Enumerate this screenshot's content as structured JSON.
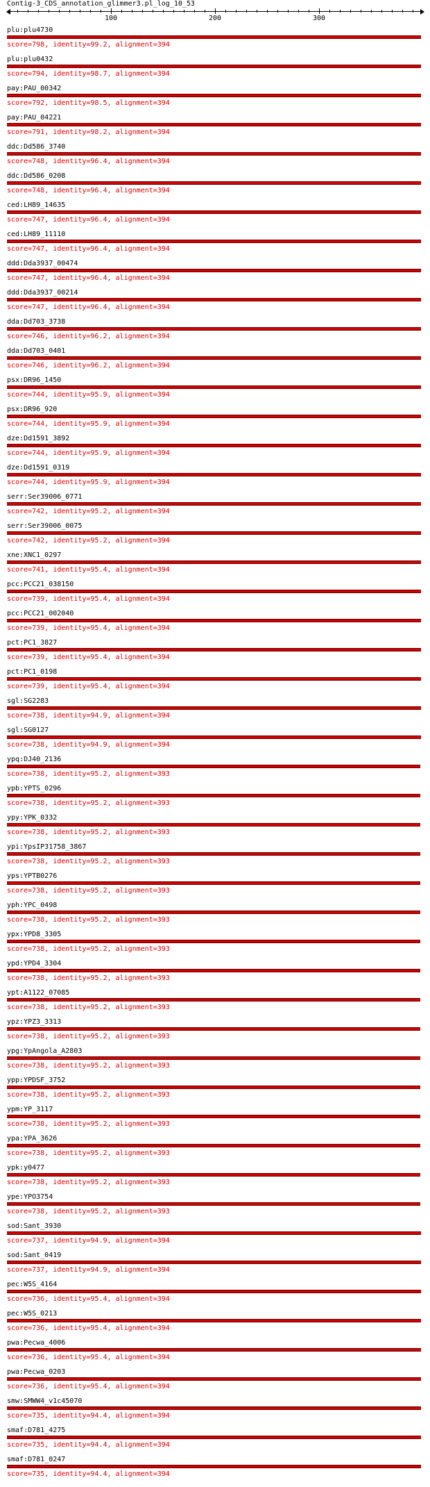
{
  "title": "Contig-3_CDS_annotation_glimmer3.pl_log_10_53",
  "axis": {
    "ticks": [
      "100",
      "200",
      "300"
    ]
  },
  "chart_data": {
    "type": "alignment",
    "query_length": 400,
    "hits": [
      {
        "name": "plu:plu4730",
        "score_line": "score=798, identity=99.2, alignment=394",
        "alignment": 394
      },
      {
        "name": "plu:plu0432",
        "score_line": "score=794, identity=98.7, alignment=394",
        "alignment": 394
      },
      {
        "name": "pay:PAU_00342",
        "score_line": "score=792, identity=98.5, alignment=394",
        "alignment": 394
      },
      {
        "name": "pay:PAU_04221",
        "score_line": "score=791, identity=98.2, alignment=394",
        "alignment": 394
      },
      {
        "name": "ddc:Dd586_3740",
        "score_line": "score=748, identity=96.4, alignment=394",
        "alignment": 394
      },
      {
        "name": "ddc:Dd586_0208",
        "score_line": "score=748, identity=96.4, alignment=394",
        "alignment": 394
      },
      {
        "name": "ced:LH89_14635",
        "score_line": "score=747, identity=96.4, alignment=394",
        "alignment": 394
      },
      {
        "name": "ced:LH89_11110",
        "score_line": "score=747, identity=96.4, alignment=394",
        "alignment": 394
      },
      {
        "name": "ddd:Dda3937_00474",
        "score_line": "score=747, identity=96.4, alignment=394",
        "alignment": 394
      },
      {
        "name": "ddd:Dda3937_00214",
        "score_line": "score=747, identity=96.4, alignment=394",
        "alignment": 394
      },
      {
        "name": "dda:Dd703_3738",
        "score_line": "score=746, identity=96.2, alignment=394",
        "alignment": 394
      },
      {
        "name": "dda:Dd703_0401",
        "score_line": "score=746, identity=96.2, alignment=394",
        "alignment": 394
      },
      {
        "name": "psx:DR96_1450",
        "score_line": "score=744, identity=95.9, alignment=394",
        "alignment": 394
      },
      {
        "name": "psx:DR96_920",
        "score_line": "score=744, identity=95.9, alignment=394",
        "alignment": 394
      },
      {
        "name": "dze:Dd1591_3892",
        "score_line": "score=744, identity=95.9, alignment=394",
        "alignment": 394
      },
      {
        "name": "dze:Dd1591_0319",
        "score_line": "score=744, identity=95.9, alignment=394",
        "alignment": 394
      },
      {
        "name": "serr:Ser39006_0771",
        "score_line": "score=742, identity=95.2, alignment=394",
        "alignment": 394
      },
      {
        "name": "serr:Ser39006_0075",
        "score_line": "score=742, identity=95.2, alignment=394",
        "alignment": 394
      },
      {
        "name": "xne:XNC1_0297",
        "score_line": "score=741, identity=95.4, alignment=394",
        "alignment": 394
      },
      {
        "name": "pcc:PCC21_038150",
        "score_line": "score=739, identity=95.4, alignment=394",
        "alignment": 394
      },
      {
        "name": "pcc:PCC21_002040",
        "score_line": "score=739, identity=95.4, alignment=394",
        "alignment": 394
      },
      {
        "name": "pct:PC1_3827",
        "score_line": "score=739, identity=95.4, alignment=394",
        "alignment": 394
      },
      {
        "name": "pct:PC1_0198",
        "score_line": "score=739, identity=95.4, alignment=394",
        "alignment": 394
      },
      {
        "name": "sgl:SG2283",
        "score_line": "score=738, identity=94.9, alignment=394",
        "alignment": 394
      },
      {
        "name": "sgl:SG0127",
        "score_line": "score=738, identity=94.9, alignment=394",
        "alignment": 394
      },
      {
        "name": "ypq:DJ40_2136",
        "score_line": "score=738, identity=95.2, alignment=393",
        "alignment": 393
      },
      {
        "name": "ypb:YPTS_0296",
        "score_line": "score=738, identity=95.2, alignment=393",
        "alignment": 393
      },
      {
        "name": "ypy:YPK_0332",
        "score_line": "score=738, identity=95.2, alignment=393",
        "alignment": 393
      },
      {
        "name": "ypi:YpsIP31758_3867",
        "score_line": "score=738, identity=95.2, alignment=393",
        "alignment": 393
      },
      {
        "name": "yps:YPTB0276",
        "score_line": "score=738, identity=95.2, alignment=393",
        "alignment": 393
      },
      {
        "name": "yph:YPC_0498",
        "score_line": "score=738, identity=95.2, alignment=393",
        "alignment": 393
      },
      {
        "name": "ypx:YPD8_3305",
        "score_line": "score=738, identity=95.2, alignment=393",
        "alignment": 393
      },
      {
        "name": "ypd:YPD4_3304",
        "score_line": "score=738, identity=95.2, alignment=393",
        "alignment": 393
      },
      {
        "name": "ypt:A1122_07085",
        "score_line": "score=738, identity=95.2, alignment=393",
        "alignment": 393
      },
      {
        "name": "ypz:YPZ3_3313",
        "score_line": "score=738, identity=95.2, alignment=393",
        "alignment": 393
      },
      {
        "name": "ypg:YpAngola_A2803",
        "score_line": "score=738, identity=95.2, alignment=393",
        "alignment": 393
      },
      {
        "name": "ypp:YPDSF_3752",
        "score_line": "score=738, identity=95.2, alignment=393",
        "alignment": 393
      },
      {
        "name": "ypm:YP_3117",
        "score_line": "score=738, identity=95.2, alignment=393",
        "alignment": 393
      },
      {
        "name": "ypa:YPA_3626",
        "score_line": "score=738, identity=95.2, alignment=393",
        "alignment": 393
      },
      {
        "name": "ypk:y0477",
        "score_line": "score=738, identity=95.2, alignment=393",
        "alignment": 393
      },
      {
        "name": "ype:YPO3754",
        "score_line": "score=738, identity=95.2, alignment=393",
        "alignment": 393
      },
      {
        "name": "sod:Sant_3930",
        "score_line": "score=737, identity=94.9, alignment=394",
        "alignment": 394
      },
      {
        "name": "sod:Sant_0419",
        "score_line": "score=737, identity=94.9, alignment=394",
        "alignment": 394
      },
      {
        "name": "pec:W5S_4164",
        "score_line": "score=736, identity=95.4, alignment=394",
        "alignment": 394
      },
      {
        "name": "pec:W5S_0213",
        "score_line": "score=736, identity=95.4, alignment=394",
        "alignment": 394
      },
      {
        "name": "pwa:Pecwa_4006",
        "score_line": "score=736, identity=95.4, alignment=394",
        "alignment": 394
      },
      {
        "name": "pwa:Pecwa_0203",
        "score_line": "score=736, identity=95.4, alignment=394",
        "alignment": 394
      },
      {
        "name": "smw:SMWW4_v1c45070",
        "score_line": "score=735, identity=94.4, alignment=394",
        "alignment": 394
      },
      {
        "name": "smaf:D781_4275",
        "score_line": "score=735, identity=94.4, alignment=394",
        "alignment": 394
      },
      {
        "name": "smaf:D781_0247",
        "score_line": "score=735, identity=94.4, alignment=394",
        "alignment": 394
      }
    ]
  }
}
